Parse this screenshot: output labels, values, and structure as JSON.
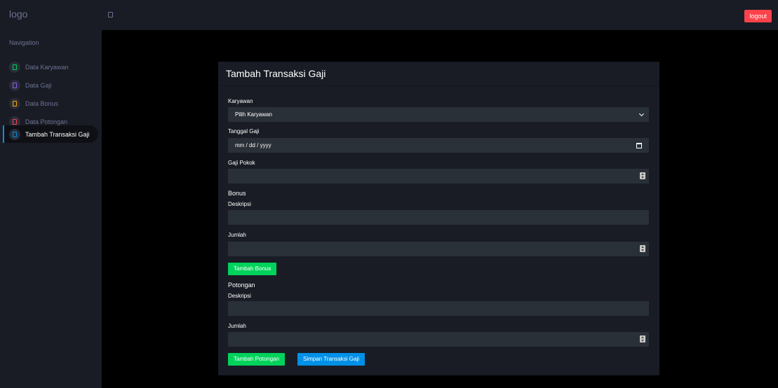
{
  "header": {
    "logo": "logo",
    "logout_label": "logout"
  },
  "sidebar": {
    "title": "Navigation",
    "items": [
      {
        "label": "Data Karyawan",
        "icon": "square-icon",
        "color": "#00d25b"
      },
      {
        "label": "Data Gaji",
        "icon": "square-icon",
        "color": "#8f5fe8"
      },
      {
        "label": "Data Bonus",
        "icon": "square-icon",
        "color": "#ffab00"
      },
      {
        "label": "Data Potongan",
        "icon": "square-icon",
        "color": "#fc424a"
      },
      {
        "label": "Tambah Transaksi Gaji",
        "icon": "square-icon",
        "color": "#0090e7",
        "active": true
      }
    ]
  },
  "form": {
    "title": "Tambah Transaksi Gaji",
    "karyawan_label": "Karyawan",
    "karyawan_value": "Pilih Karyawan",
    "tanggal_label": "Tanggal Gaji",
    "tanggal_value": "mm / dd / yyyy",
    "gaji_pokok_label": "Gaji Pokok",
    "bonus_heading": "Bonus",
    "bonus_deskripsi_label": "Deskripsi",
    "bonus_jumlah_label": "Jumlah",
    "tambah_bonus_label": "Tambah Bonus",
    "potongan_heading": "Potongan",
    "potongan_deskripsi_label": "Deskripsi",
    "potongan_jumlah_label": "Jumlah",
    "tambah_potongan_label": "Tambah Potongan",
    "simpan_label": "Simpan Transaksi Gaji"
  },
  "colors": {
    "accent_green": "#00d25b",
    "accent_blue": "#0090e7",
    "logout_red": "#fc424a"
  }
}
